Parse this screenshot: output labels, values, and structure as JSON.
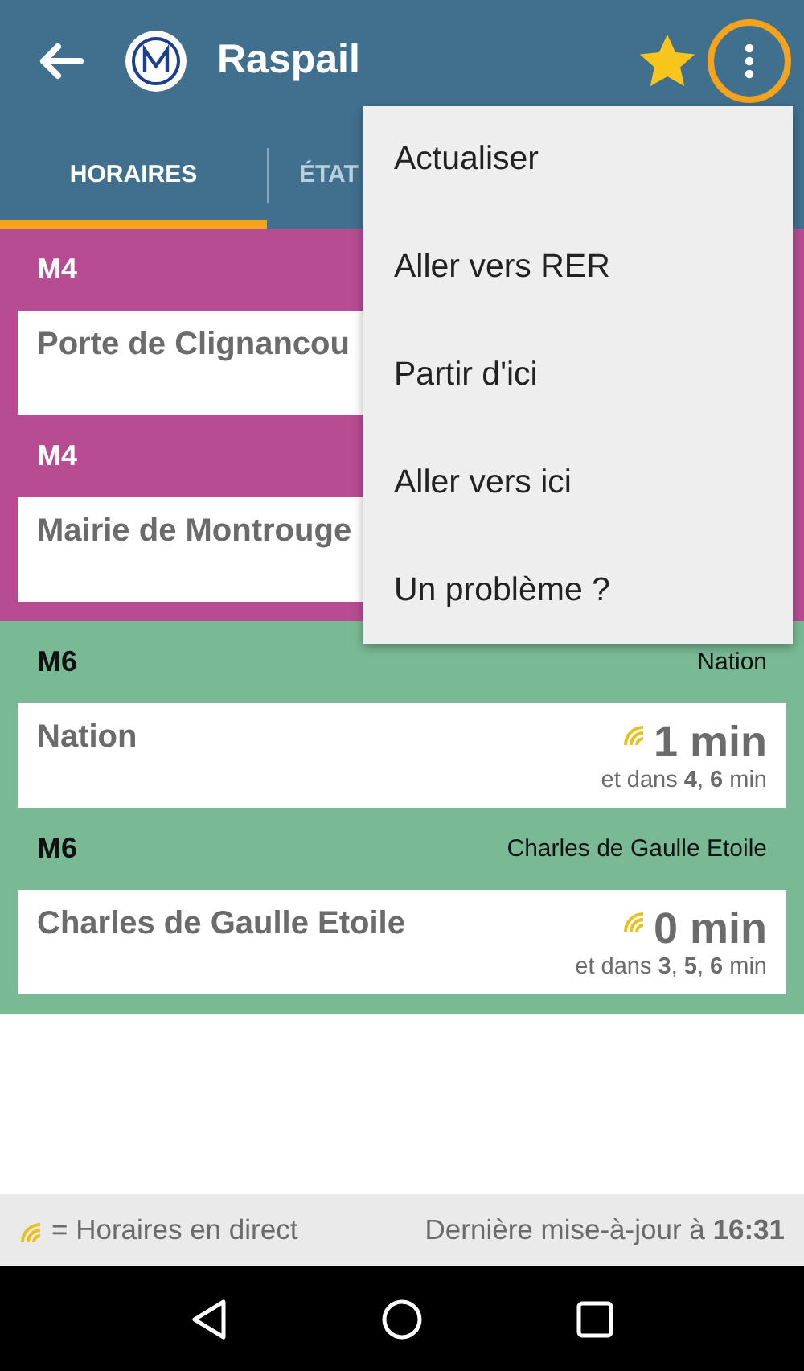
{
  "header": {
    "title": "Raspail",
    "favorite": true,
    "menu_highlighted": true
  },
  "tabs": [
    {
      "label": "HORAIRES",
      "selected": true
    },
    {
      "label": "ÉTAT",
      "selected": false
    }
  ],
  "sections": [
    {
      "color": "#b84c93",
      "groups": [
        {
          "line": "M4",
          "card": {
            "station": "Porte de Clignancou"
          }
        },
        {
          "line": "M4",
          "card": {
            "station": "Mairie de Montrouge"
          }
        }
      ]
    },
    {
      "color": "#79ba95",
      "groups": [
        {
          "line": "M6",
          "direction": "Nation",
          "card": {
            "station": "Nation",
            "live": true,
            "time": "1 min",
            "next": "et dans **4**, **6** min"
          }
        },
        {
          "line": "M6",
          "direction": "Charles de Gaulle Etoile",
          "card": {
            "station": "Charles de Gaulle Etoile",
            "live": true,
            "time": "0 min",
            "next": "et dans **3**, **5**, **6** min"
          }
        }
      ]
    }
  ],
  "menu": {
    "items": [
      "Actualiser",
      "Aller vers RER",
      "Partir d'ici",
      "Aller vers ici",
      "Un problème ?"
    ]
  },
  "footer": {
    "legend": "= Horaires en direct",
    "updated": "Dernière mise-à-jour à **16:31**"
  }
}
